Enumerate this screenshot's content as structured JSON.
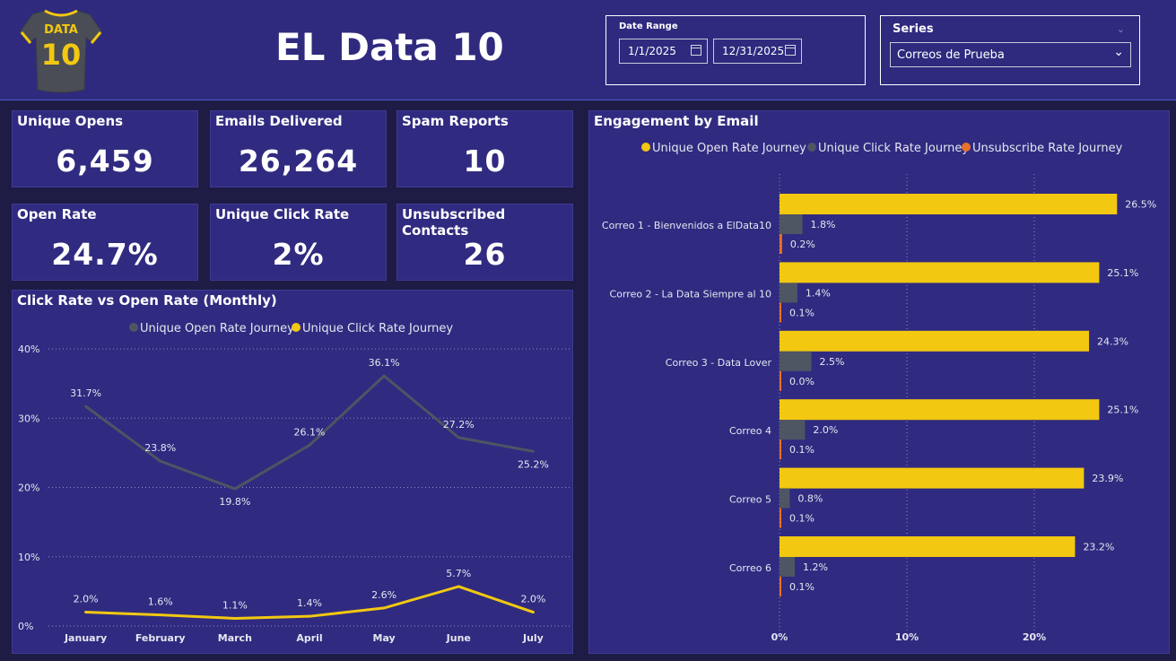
{
  "header": {
    "title": "EL Data 10",
    "logo_text_top": "DATA",
    "logo_text_number": "10"
  },
  "date_range": {
    "label": "Date Range",
    "start": "1/1/2025",
    "end": "12/31/2025",
    "icon": "calendar-icon"
  },
  "series_slicer": {
    "label": "Series",
    "selected": "Correos de Prueba",
    "icon": "chevron-down-icon"
  },
  "kpis": [
    {
      "title": "Unique Opens",
      "value": "6,459"
    },
    {
      "title": "Emails Delivered",
      "value": "26,264"
    },
    {
      "title": "Spam Reports",
      "value": "10"
    },
    {
      "title": "Open Rate",
      "value": "24.7%"
    },
    {
      "title": "Unique Click Rate",
      "value": "2%"
    },
    {
      "title": "Unsubscribed Contacts",
      "value": "26"
    }
  ],
  "colors": {
    "yellow": "#f2c811",
    "gray": "#4e5563",
    "orange": "#e8702a",
    "panel": "#302b80",
    "background": "#1e1c44"
  },
  "chart_data": [
    {
      "type": "line",
      "title": "Click Rate vs Open Rate (Monthly)",
      "categories": [
        "January",
        "February",
        "March",
        "April",
        "May",
        "June",
        "July"
      ],
      "series": [
        {
          "name": "Unique Open Rate Journey",
          "color": "#4e5563",
          "values": [
            31.7,
            23.8,
            19.8,
            26.1,
            36.1,
            27.2,
            25.2
          ],
          "labels": [
            "31.7%",
            "23.8%",
            "19.8%",
            "26.1%",
            "36.1%",
            "27.2%",
            "25.2%"
          ]
        },
        {
          "name": "Unique Click Rate Journey",
          "color": "#f2c811",
          "values": [
            2.0,
            1.6,
            1.1,
            1.4,
            2.6,
            5.7,
            2.0
          ],
          "labels": [
            "2.0%",
            "1.6%",
            "1.1%",
            "1.4%",
            "2.6%",
            "5.7%",
            "2.0%"
          ]
        }
      ],
      "ylim": [
        0,
        40
      ],
      "yticks": [
        "0%",
        "10%",
        "20%",
        "30%",
        "40%"
      ],
      "grid": true,
      "legend": "top-center"
    },
    {
      "type": "bar",
      "orientation": "horizontal",
      "title": "Engagement by Email",
      "categories": [
        "Correo 1 - Bienvenidos a ElData10",
        "Correo 2 - La Data Siempre al 10",
        "Correo 3 - Data Lover",
        "Correo 4",
        "Correo 5",
        "Correo 6"
      ],
      "series": [
        {
          "name": "Unique Open Rate Journey",
          "color": "#f2c811",
          "values": [
            26.5,
            25.1,
            24.3,
            25.1,
            23.9,
            23.2
          ],
          "labels": [
            "26.5%",
            "25.1%",
            "24.3%",
            "25.1%",
            "23.9%",
            "23.2%"
          ]
        },
        {
          "name": "Unique Click Rate Journey",
          "color": "#4e5563",
          "values": [
            1.8,
            1.4,
            2.5,
            2.0,
            0.8,
            1.2
          ],
          "labels": [
            "1.8%",
            "1.4%",
            "2.5%",
            "2.0%",
            "0.8%",
            "1.2%"
          ]
        },
        {
          "name": "Unsubscribe Rate Journey",
          "color": "#e8702a",
          "values": [
            0.2,
            0.1,
            0.0,
            0.1,
            0.1,
            0.1
          ],
          "labels": [
            "0.2%",
            "0.1%",
            "0.0%",
            "0.1%",
            "0.1%",
            "0.1%"
          ]
        }
      ],
      "xticks": [
        "0%",
        "10%",
        "20%"
      ],
      "grid": true,
      "legend": "top-center"
    }
  ]
}
